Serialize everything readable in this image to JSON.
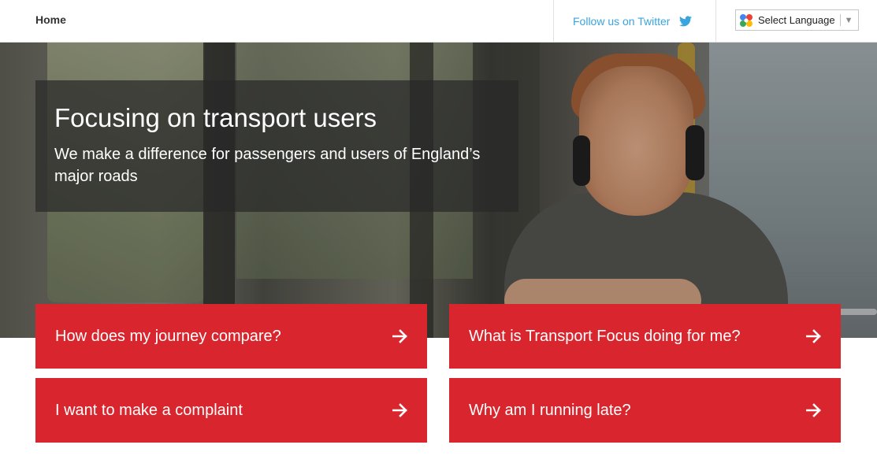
{
  "nav": {
    "home_label": "Home",
    "twitter_label": "Follow us on Twitter",
    "twitter_icon": "twitter-bird-icon",
    "language": {
      "selected": "Select Language",
      "icon": "google-translate-icon"
    }
  },
  "hero": {
    "title": "Focusing on transport users",
    "subtitle": "We make a difference for passengers and users of England’s major roads",
    "image_subject": "young man with headphones looking out of a bus window"
  },
  "actions": [
    {
      "label": "How does my journey compare?",
      "icon": "arrow-right-icon"
    },
    {
      "label": "What is Transport Focus doing for me?",
      "icon": "arrow-right-icon"
    },
    {
      "label": "I want to make a complaint",
      "icon": "arrow-right-icon"
    },
    {
      "label": "Why am I running late?",
      "icon": "arrow-right-icon"
    }
  ],
  "colors": {
    "accent_red": "#d9262e",
    "twitter_blue": "#3aa4de",
    "panel_overlay": "rgba(40,40,40,0.72)"
  }
}
